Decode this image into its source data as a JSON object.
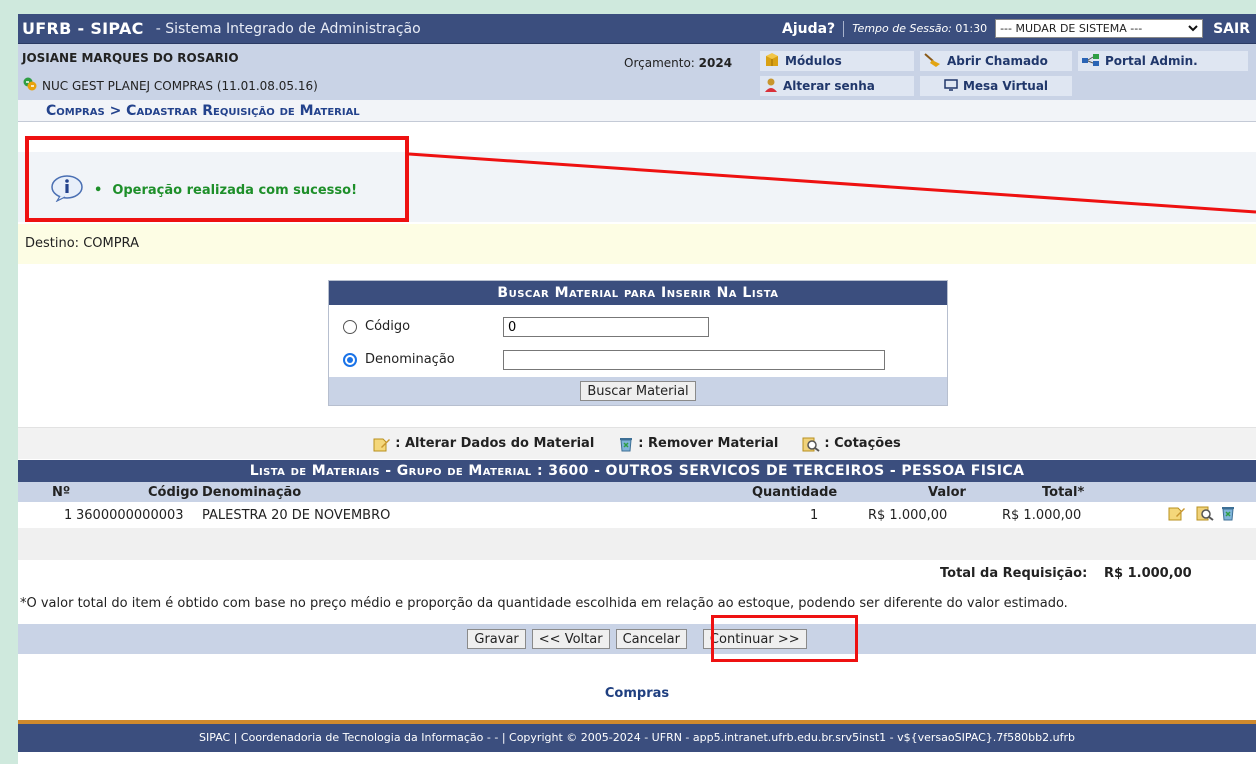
{
  "header": {
    "brand": "UFRB - SIPAC",
    "system_name": "- Sistema Integrado de Administração",
    "help": "Ajuda?",
    "session_label": "Tempo de Sessão:",
    "session_time": "01:30",
    "system_select": "--- MUDAR DE SISTEMA ---",
    "logout": "SAIR"
  },
  "user": {
    "name": "JOSIANE MARQUES DO ROSARIO",
    "unit": "NUC GEST PLANEJ COMPRAS (11.01.08.05.16)",
    "budget_label": "Orçamento:",
    "budget_year": "2024"
  },
  "menu": {
    "modulos": "Módulos",
    "abrir_chamado": "Abrir Chamado",
    "portal_admin": "Portal Admin.",
    "alterar_senha": "Alterar senha",
    "mesa_virtual": "Mesa Virtual"
  },
  "breadcrumb": "Compras > Cadastrar Requisição de Material",
  "message": "Operação realizada com sucesso!",
  "destino": "Destino: COMPRA",
  "search": {
    "title": "Buscar Material para Inserir Na Lista",
    "codigo_label": "Código",
    "codigo_value": "0",
    "denominacao_label": "Denominação",
    "denominacao_value": "",
    "selected": "Denominação",
    "button": "Buscar Material"
  },
  "legend": {
    "alterar": ": Alterar Dados do Material",
    "remover": ": Remover Material",
    "cotacoes": ": Cotações"
  },
  "materials": {
    "title": "Lista de Materiais - Grupo de Material : 3600 - OUTROS SERVICOS DE TERCEIROS - PESSOA FISICA",
    "columns": {
      "num": "Nº",
      "codigo": "Código",
      "denominacao": "Denominação",
      "quantidade": "Quantidade",
      "valor": "Valor",
      "total": "Total*"
    },
    "rows": [
      {
        "num": "1",
        "codigo": "3600000000003",
        "denominacao": "PALESTRA 20 DE NOVEMBRO",
        "quantidade": "1",
        "valor": "R$ 1.000,00",
        "total": "R$ 1.000,00"
      }
    ],
    "total_label": "Total da Requisição:",
    "total_value": "R$ 1.000,00"
  },
  "note": "*O valor total do item é obtido com base no preço médio e proporção da quantidade escolhida em relação ao estoque, podendo ser diferente do valor estimado.",
  "buttons": {
    "gravar": "Gravar",
    "voltar": "<< Voltar",
    "cancelar": "Cancelar",
    "continuar": "Continuar >>"
  },
  "footer_link": "Compras",
  "footer": "SIPAC | Coordenadoria de Tecnologia da Informação - - | Copyright © 2005-2024 - UFRN - app5.intranet.ufrb.edu.br.srv5inst1 - v${versaoSIPAC}.7f580bb2.ufrb",
  "colors": {
    "header_bg": "#3b4e7e",
    "panel_bg": "#c9d3e6",
    "success": "#1e8f2a",
    "highlight": "#e11111",
    "footer_accent": "#d08a2c"
  }
}
